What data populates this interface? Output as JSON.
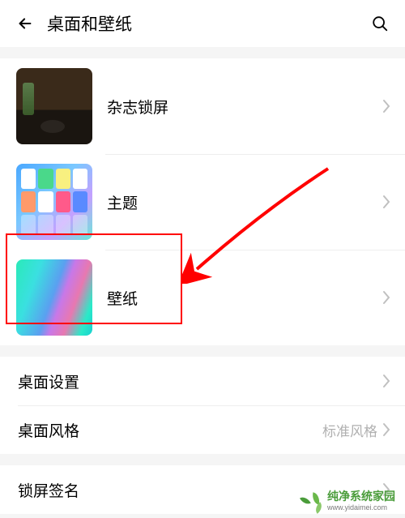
{
  "header": {
    "title": "桌面和壁纸"
  },
  "items": {
    "lockscreen": {
      "label": "杂志锁屏"
    },
    "theme": {
      "label": "主题"
    },
    "wallpaper": {
      "label": "壁纸"
    },
    "desktop_settings": {
      "label": "桌面设置"
    },
    "desktop_style": {
      "label": "桌面风格",
      "value": "标准风格"
    },
    "lockscreen_signature": {
      "label": "锁屏签名"
    }
  },
  "highlight": {
    "color": "#ff0000",
    "target": "wallpaper"
  },
  "watermark": {
    "brand": "纯净系统家园",
    "url": "www.yidaimei.com"
  }
}
